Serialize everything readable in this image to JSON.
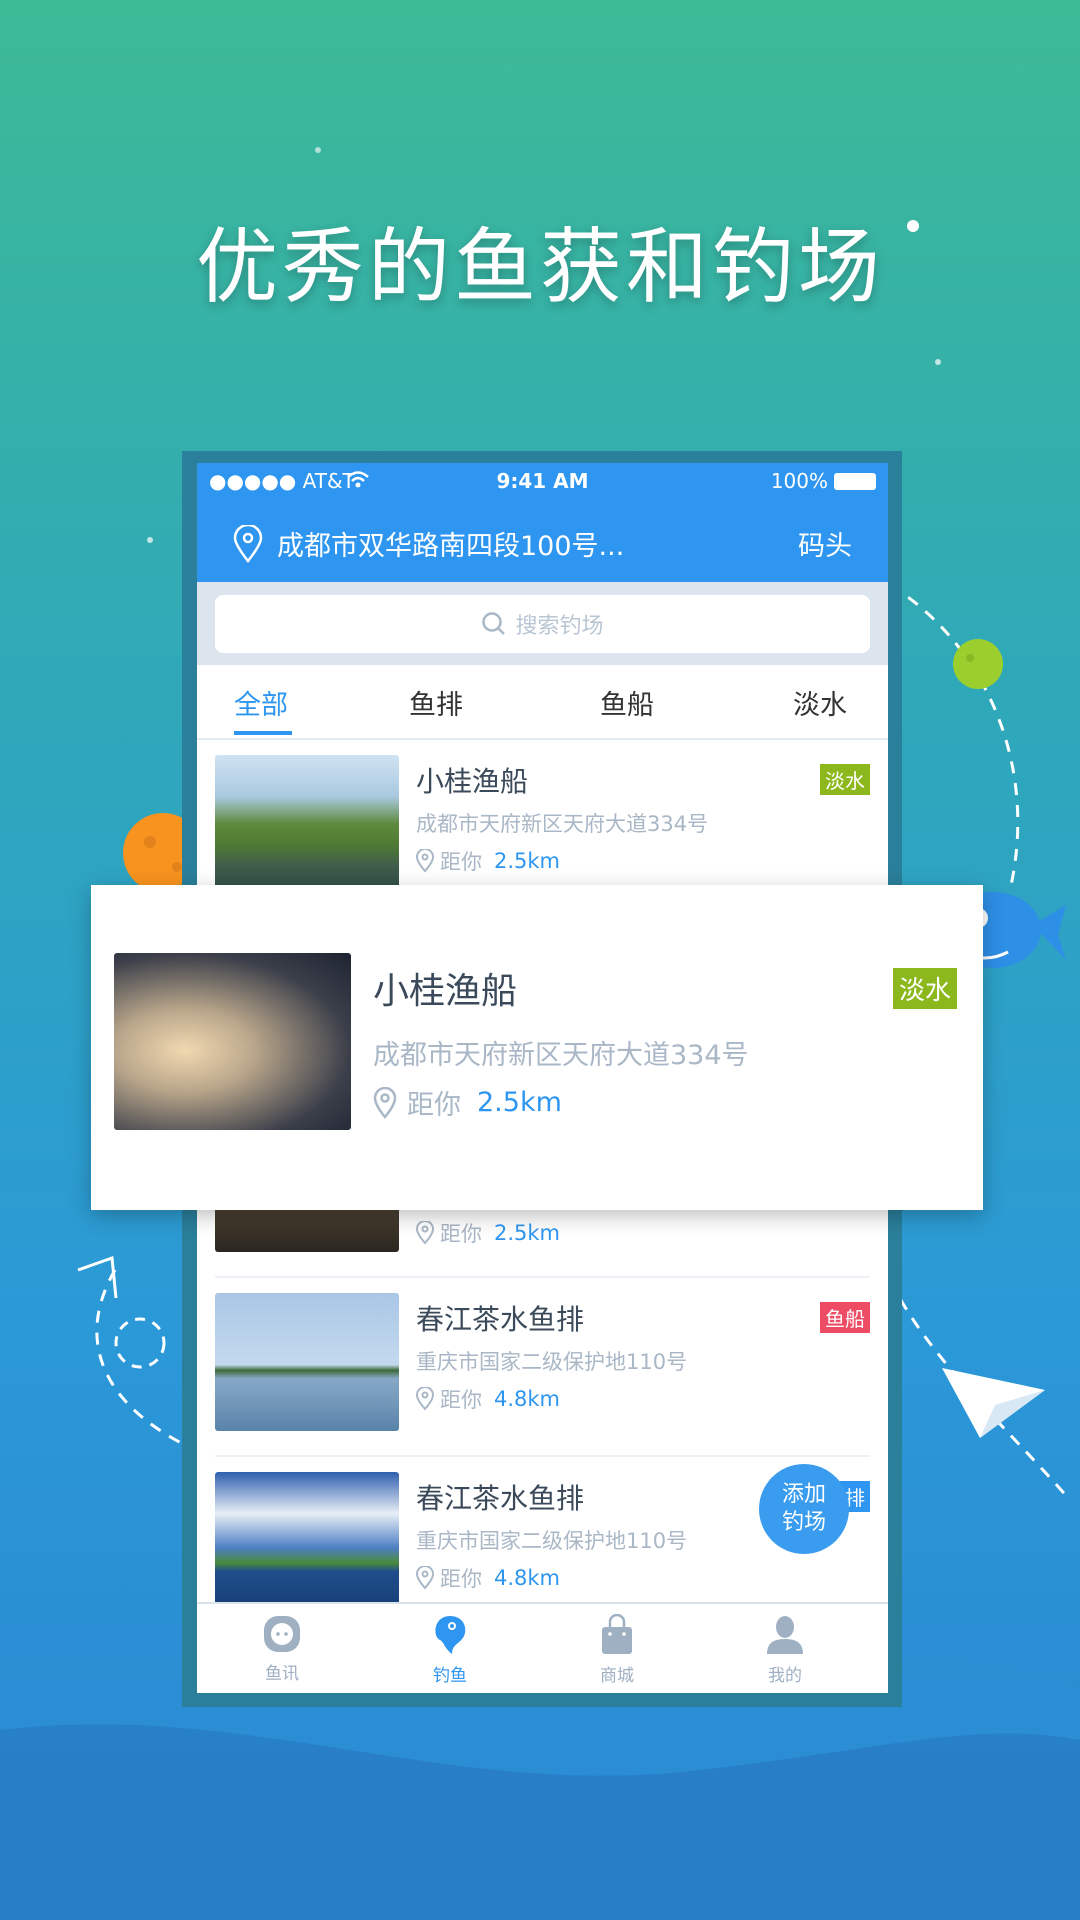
{
  "headline": "优秀的鱼获和钓场",
  "status_bar": {
    "carrier": "●●●●● AT&T",
    "time": "9:41 AM",
    "battery": "100%"
  },
  "header": {
    "location": "成都市双华路南四段100号...",
    "right_label": "码头"
  },
  "search": {
    "placeholder": "搜索钓场"
  },
  "tabs": [
    {
      "label": "全部",
      "active": true
    },
    {
      "label": "鱼排"
    },
    {
      "label": "鱼船"
    },
    {
      "label": "淡水"
    }
  ],
  "list": [
    {
      "name": "小桂渔船",
      "address": "成都市天府新区天府大道334号",
      "distance_label": "距你",
      "distance": "2.5km",
      "tag": "淡水",
      "tag_color": "#8cb81d"
    },
    {
      "name": "",
      "address": "",
      "distance_label": "距你",
      "distance": "2.5km",
      "tag": "",
      "tag_color": ""
    },
    {
      "name": "春江茶水鱼排",
      "address": "重庆市国家二级保护地110号",
      "distance_label": "距你",
      "distance": "4.8km",
      "tag": "鱼船",
      "tag_color": "#ee4c64"
    },
    {
      "name": "春江茶水鱼排",
      "address": "重庆市国家二级保护地110号",
      "distance_label": "距你",
      "distance": "4.8km",
      "tag": "鱼排",
      "tag_color": "#2e96f0"
    }
  ],
  "popup": {
    "name": "小桂渔船",
    "address": "成都市天府新区天府大道334号",
    "distance_label": "距你",
    "distance": "2.5km",
    "tag": "淡水",
    "tag_color": "#8cb81d"
  },
  "add_button": {
    "line1": "添加",
    "line2": "钓场"
  },
  "tabbar": [
    {
      "label": "鱼讯",
      "icon": "chat-icon"
    },
    {
      "label": "钓鱼",
      "icon": "fish-icon",
      "active": true
    },
    {
      "label": "商城",
      "icon": "bag-icon"
    },
    {
      "label": "我的",
      "icon": "user-icon"
    }
  ],
  "colors": {
    "primary": "#2e96f0",
    "inactive": "#9fb0c3"
  }
}
